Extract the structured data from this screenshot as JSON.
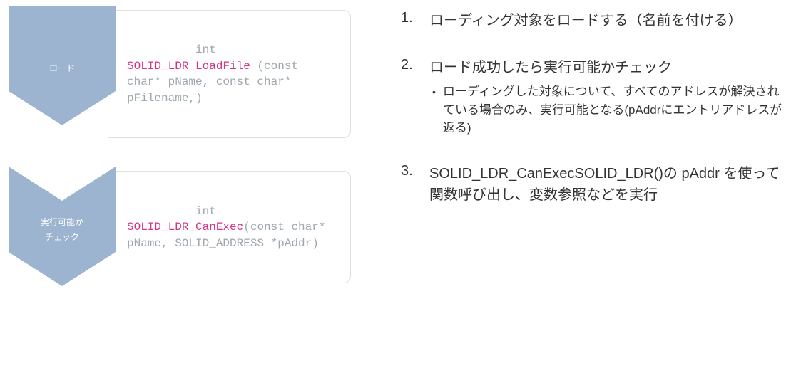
{
  "flow": {
    "items": [
      {
        "label_line1": "ロード",
        "label_line2": "",
        "code_prefix": "int ",
        "code_fn": "SOLID_LDR_LoadFile",
        "code_suffix": " (const char* pName, const char* pFilename,)"
      },
      {
        "label_line1": "実行可能か",
        "label_line2": "チェック",
        "code_prefix": "int ",
        "code_fn": "SOLID_LDR_CanExec",
        "code_suffix": "(const char* pName, SOLID_ADDRESS *pAddr)"
      }
    ]
  },
  "steps": [
    {
      "num": "1.",
      "title": "ローディング対象をロードする（名前を付ける）",
      "bullets": []
    },
    {
      "num": "2.",
      "title": "ロード成功したら実行可能かチェック",
      "bullets": [
        "ローディングした対象について、すべてのアドレスが解決されている場合のみ、実行可能となる(pAddrにエントリアドレスが返る)"
      ]
    },
    {
      "num": "3.",
      "title": "SOLID_LDR_CanExecSOLID_LDR()の pAddr を使って関数呼び出し、変数参照などを実行",
      "bullets": []
    }
  ],
  "colors": {
    "chevron_fill": "#9cb4cf",
    "code_fn": "#d63384"
  }
}
